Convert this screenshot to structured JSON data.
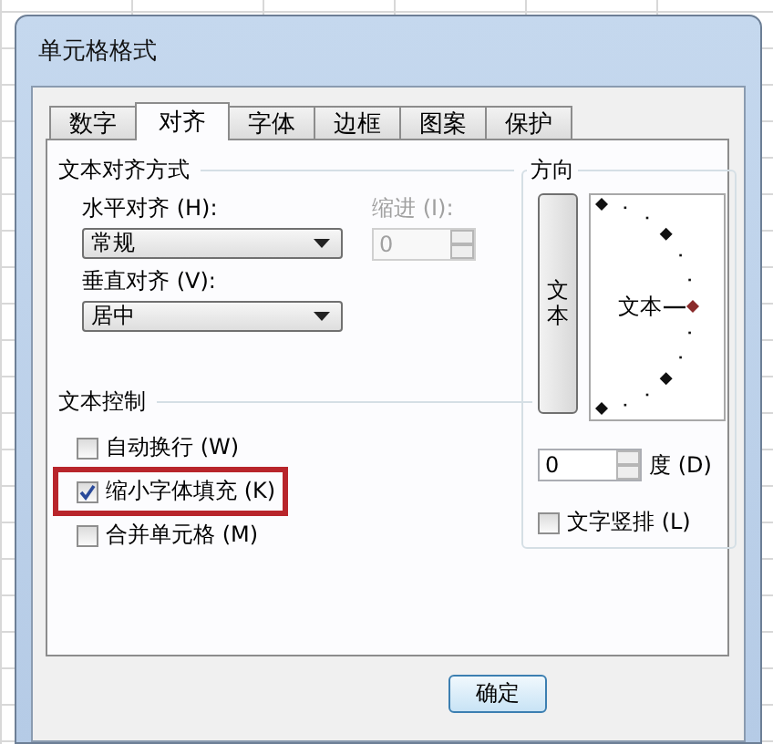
{
  "window": {
    "title": "单元格格式"
  },
  "tabs": [
    {
      "label": "数字",
      "selected": false
    },
    {
      "label": "对齐",
      "selected": true
    },
    {
      "label": "字体",
      "selected": false
    },
    {
      "label": "边框",
      "selected": false
    },
    {
      "label": "图案",
      "selected": false
    },
    {
      "label": "保护",
      "selected": false
    }
  ],
  "text_alignment": {
    "title": "文本对齐方式",
    "horizontal": {
      "label": "水平对齐 (H):",
      "value": "常规"
    },
    "vertical": {
      "label": "垂直对齐 (V):",
      "value": "居中"
    },
    "indent": {
      "label": "缩进 (I):",
      "value": "0",
      "disabled": true
    }
  },
  "text_control": {
    "title": "文本控制",
    "options": [
      {
        "label": "自动换行 (W)",
        "checked": false,
        "highlighted": false
      },
      {
        "label": "缩小字体填充 (K)",
        "checked": true,
        "highlighted": true
      },
      {
        "label": "合并单元格 (M)",
        "checked": false,
        "highlighted": false
      }
    ]
  },
  "orientation": {
    "title": "方向",
    "vertical_text_button": "文本",
    "dial_label": "文本",
    "degrees": {
      "value": "0",
      "label": "度 (D)"
    },
    "vertical_text": {
      "label": "文字竖排 (L)",
      "checked": false
    }
  },
  "buttons": [
    {
      "label": "确定"
    }
  ]
}
